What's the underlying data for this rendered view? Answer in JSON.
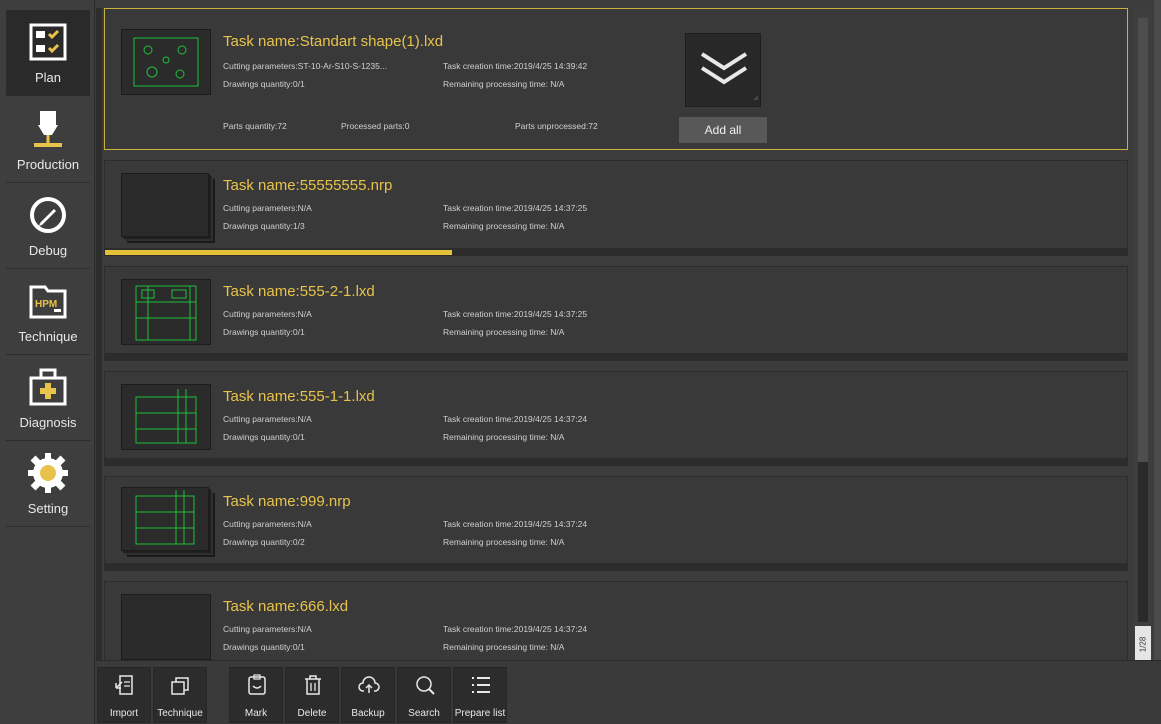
{
  "sidebar": {
    "items": [
      {
        "label": "Plan",
        "icon": "plan-checklist-icon"
      },
      {
        "label": "Production",
        "icon": "laser-head-icon"
      },
      {
        "label": "Debug",
        "icon": "pen-circle-icon"
      },
      {
        "label": "Technique",
        "icon": "hpm-folder-icon"
      },
      {
        "label": "Diagnosis",
        "icon": "first-aid-kit-icon"
      },
      {
        "label": "Setting",
        "icon": "gear-icon"
      }
    ],
    "hpm_text": "HPM"
  },
  "tasks": [
    {
      "name": "Task name:Standart shape(1).lxd",
      "cutting": "Cutting parameters:ST-10-Ar-S10-S-1235...",
      "drawings": "Drawings quantity:0/1",
      "created": "Task creation time:2019/4/25 14:39:42",
      "remaining": "Remaining processing time: N/A",
      "parts_quantity": "Parts quantity:72",
      "processed_parts": "Processed parts:0",
      "parts_unprocessed": "Parts unprocessed:72",
      "add_all": "Add all"
    },
    {
      "name": "Task name:55555555.nrp",
      "cutting": "Cutting parameters:N/A",
      "drawings": "Drawings quantity:1/3",
      "created": "Task creation time:2019/4/25 14:37:25",
      "remaining": "Remaining processing time: N/A",
      "progress": 0.34
    },
    {
      "name": "Task name:555-2-1.lxd",
      "cutting": "Cutting parameters:N/A",
      "drawings": "Drawings quantity:0/1",
      "created": "Task creation time:2019/4/25 14:37:25",
      "remaining": "Remaining processing time: N/A"
    },
    {
      "name": "Task name:555-1-1.lxd",
      "cutting": "Cutting parameters:N/A",
      "drawings": "Drawings quantity:0/1",
      "created": "Task creation time:2019/4/25 14:37:24",
      "remaining": "Remaining processing time: N/A"
    },
    {
      "name": "Task name:999.nrp",
      "cutting": "Cutting parameters:N/A",
      "drawings": "Drawings quantity:0/2",
      "created": "Task creation time:2019/4/25 14:37:24",
      "remaining": "Remaining processing time: N/A"
    },
    {
      "name": "Task name:666.lxd",
      "cutting": "Cutting parameters:N/A",
      "drawings": "Drawings quantity:0/1",
      "created": "Task creation time:2019/4/25 14:37:24",
      "remaining": "Remaining processing time: N/A"
    }
  ],
  "scrollbar": {
    "page_indicator": "1/28"
  },
  "toolbar": {
    "import": "Import",
    "technique": "Technique",
    "mark": "Mark",
    "delete": "Delete",
    "backup": "Backup",
    "search": "Search",
    "prepare_list": "Prepare list"
  },
  "colors": {
    "accent_yellow": "#e8c34b",
    "drawing_green": "#1fbf3a",
    "background": "#3c3c3c"
  }
}
